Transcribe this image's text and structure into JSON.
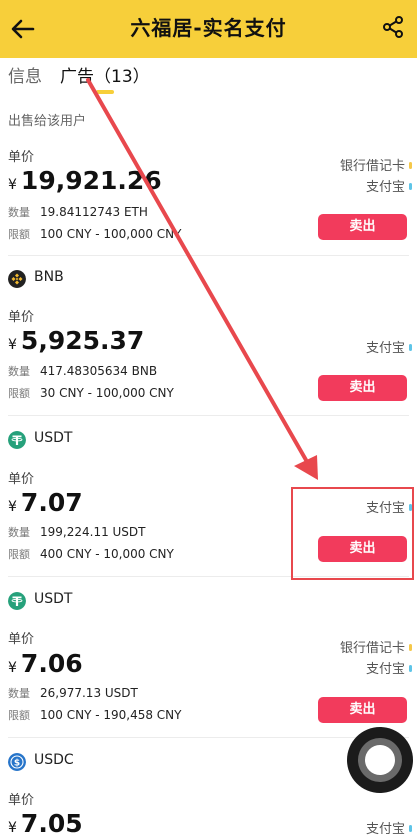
{
  "header": {
    "title": "六福居-实名支付"
  },
  "tabs": {
    "info": "信息",
    "ads": "广告（13）"
  },
  "section_label": "出售给该用户",
  "labels": {
    "price": "单价",
    "quantity": "数量",
    "limit": "限额",
    "currency_symbol": "¥"
  },
  "listings": [
    {
      "coin": "",
      "price": "19,921.26",
      "quantity": "19.84112743 ETH",
      "limit": "100 CNY - 100,000 CNY",
      "payments": [
        "银行借记卡",
        "支付宝"
      ],
      "action": "卖出"
    },
    {
      "coin": "BNB",
      "price": "5,925.37",
      "quantity": "417.48305634 BNB",
      "limit": "30 CNY - 100,000 CNY",
      "payments": [
        "支付宝"
      ],
      "action": "卖出"
    },
    {
      "coin": "USDT",
      "price": "7.07",
      "quantity": "199,224.11 USDT",
      "limit": "400 CNY - 10,000 CNY",
      "payments": [
        "支付宝"
      ],
      "action": "卖出"
    },
    {
      "coin": "USDT",
      "price": "7.06",
      "quantity": "26,977.13 USDT",
      "limit": "100 CNY - 190,458 CNY",
      "payments": [
        "银行借记卡",
        "支付宝"
      ],
      "action": "卖出"
    },
    {
      "coin": "USDC",
      "price": "7.05",
      "payments": [
        "支付宝"
      ]
    }
  ],
  "colors": {
    "header": "#f7cf3a",
    "sell_button": "#f23b5c",
    "bank_dot": "#f5c84a",
    "alipay_dot": "#5fc5e8",
    "bnb": "#f3ba2f",
    "usdt": "#26a17b",
    "usdc": "#2775ca",
    "annotation": "#e8484d"
  },
  "icons": {
    "back": "arrow-left-icon",
    "share": "share-icon",
    "bnb": "bnb-logo-icon",
    "usdt": "usdt-logo-icon",
    "usdc": "usdc-logo-icon"
  }
}
